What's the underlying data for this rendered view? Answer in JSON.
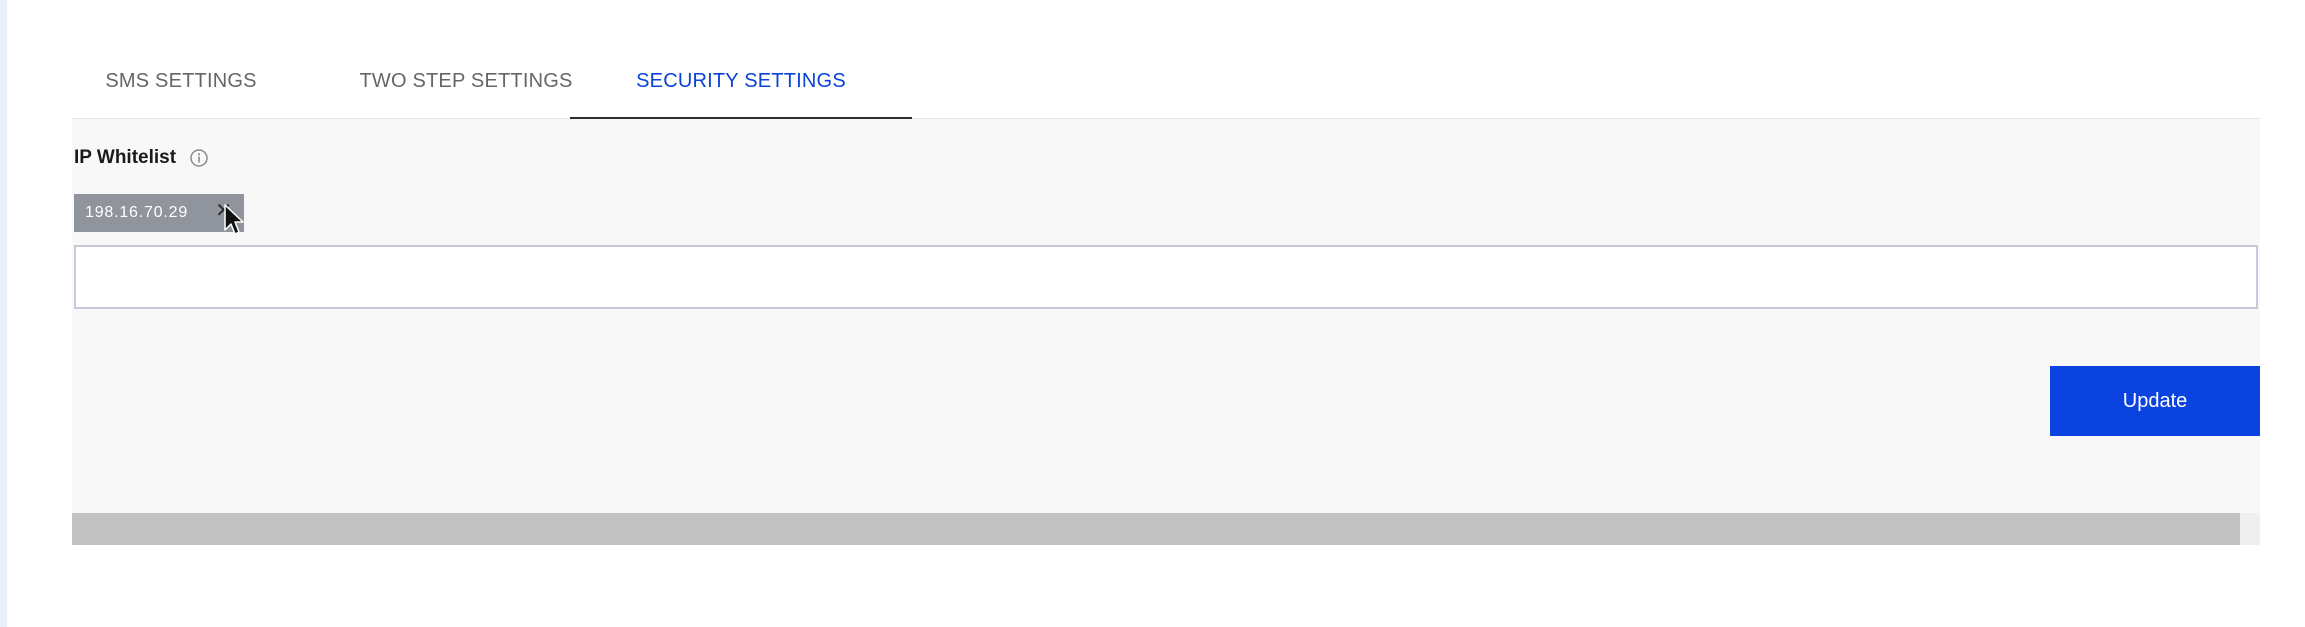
{
  "tabs": [
    {
      "label": "SMS SETTINGS",
      "active": false
    },
    {
      "label": "TWO STEP SETTINGS",
      "active": false
    },
    {
      "label": "SECURITY SETTINGS",
      "active": true
    }
  ],
  "ip_whitelist": {
    "label": "IP Whitelist",
    "info_icon": "info-circle-icon",
    "chips": [
      {
        "value": "198.16.70.29",
        "remove_icon": "close-icon"
      }
    ],
    "input_value": "",
    "input_placeholder": ""
  },
  "actions": {
    "update_label": "Update"
  },
  "colors": {
    "accent": "#0a43e0",
    "active_tab_text": "#0a43d8",
    "chip_background": "#8f949d",
    "panel_background": "#f8f8f8"
  }
}
